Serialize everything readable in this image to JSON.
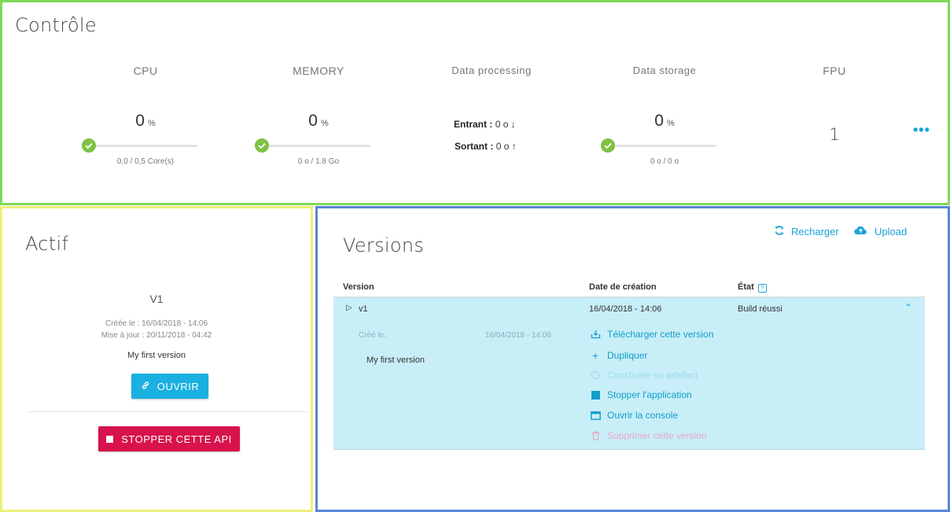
{
  "controle": {
    "title": "Contrôle",
    "cpu": {
      "label": "CPU",
      "value": "0",
      "unit": "%",
      "usage": "0,0 / 0,5 Core(s)",
      "level": 0
    },
    "memory": {
      "label": "MEMORY",
      "value": "0",
      "unit": "%",
      "usage": "0 o / 1.8 Go",
      "level": 0
    },
    "data_processing": {
      "label": "Data processing",
      "in_label": "Entrant :",
      "in_value": "0 o",
      "out_label": "Sortant :",
      "out_value": "0 o"
    },
    "data_storage": {
      "label": "Data storage",
      "value": "0",
      "unit": "%",
      "usage": "0 o / 0 o",
      "level": 0
    },
    "fpu": {
      "label": "FPU",
      "value": "1"
    },
    "more": "•••"
  },
  "actif": {
    "title": "Actif",
    "version": "V1",
    "created": "Créée le  : 16/04/2018 - 14:06",
    "updated": "Mise à jour : 20/11/2018 - 04:42",
    "description": "My first version",
    "open_button": "OUVRIR",
    "stop_button": "STOPPER CETTE API"
  },
  "versions": {
    "title": "Versions",
    "reload": "Recharger",
    "upload": "Upload",
    "headers": {
      "version": "Version",
      "date": "Date de création",
      "state": "État"
    },
    "row": {
      "name": "v1",
      "date": "16/04/2018 - 14:06",
      "state": "Build réussi",
      "created_label": "Créé le:",
      "created_value": "16/04/2018 - 14:06",
      "description": "My first version"
    },
    "actions": {
      "download": "Télécharger cette version",
      "duplicate": "Dupliquer",
      "build": "Construire un artefact",
      "stop": "Stopper l'application",
      "console": "Ouvrir la console",
      "delete": "Supprimer cette version"
    }
  },
  "colors": {
    "accent": "#1aa3d9",
    "ok": "#7cc245",
    "danger": "#d8124c",
    "row_bg": "#c8eef8",
    "frame_controle": "#7fd85a",
    "frame_actif": "#eef07a",
    "frame_versions": "#5a86d6"
  }
}
